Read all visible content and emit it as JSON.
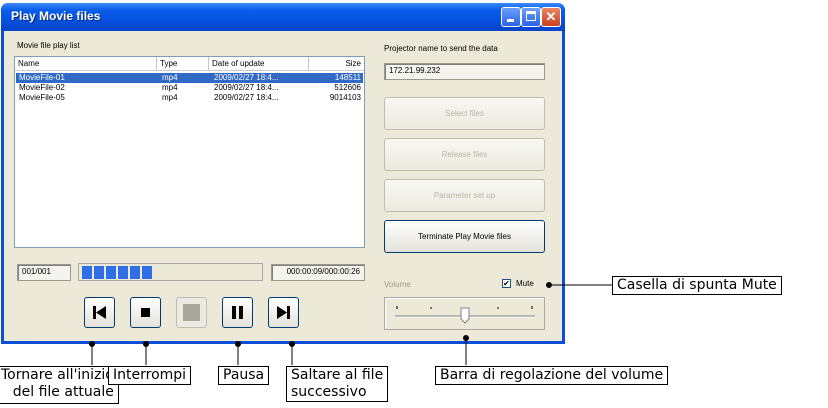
{
  "window": {
    "title": "Play Movie files",
    "title_buttons": [
      "minimize-icon",
      "maximize-icon",
      "close-icon"
    ]
  },
  "list_section": {
    "label": "Movie file play list",
    "columns": [
      "Name",
      "Type",
      "Date of update",
      "Size"
    ],
    "rows": [
      {
        "name": "MovieFile-01",
        "type": "mp4",
        "date": "2009/02/27 18:4...",
        "size": "148511",
        "selected": true
      },
      {
        "name": "MovieFile-02",
        "type": "mp4",
        "date": "2009/02/27 18:4...",
        "size": "512606",
        "selected": false
      },
      {
        "name": "MovieFile-05",
        "type": "mp4",
        "date": "2009/02/27 18:4...",
        "size": "9014103",
        "selected": false
      }
    ]
  },
  "playback": {
    "counter": "001/001",
    "progress_segments": 6,
    "time": "000:00:09/000:00:26"
  },
  "projector": {
    "label": "Projector name to send the data",
    "value": "172.21.99.232"
  },
  "buttons": {
    "select_files": "Select files",
    "release_files": "Release files",
    "parameter_set_up": "Parameter set up",
    "terminate": "Terminate Play Movie files"
  },
  "transport": {
    "skip_back_icon": "skip-to-start-icon",
    "stop_icon": "stop-icon",
    "play_icon": "play-disabled-icon",
    "pause_icon": "pause-icon",
    "skip_next_icon": "skip-to-next-icon"
  },
  "volume": {
    "label": "Volume",
    "mute_label": "Mute",
    "mute_checked": true,
    "level": 0.5
  },
  "callouts": {
    "restart": "Tornare all'inizio\ndel file attuale",
    "stop": "Interrompi",
    "pause": "Pausa",
    "next": "Saltare al file\nsuccessivo",
    "mute": "Casella di spunta Mute",
    "volume_bar": "Barra di regolazione del volume"
  },
  "colors": {
    "titlebar": "#0a5ee9",
    "selection": "#316ac5",
    "progress": "#2f6ee6",
    "window_bg": "#ece9d8"
  }
}
